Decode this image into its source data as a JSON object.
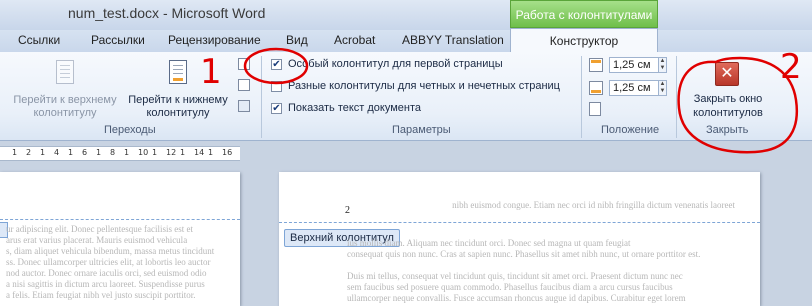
{
  "window": {
    "title": "num_test.docx  -  Microsoft Word"
  },
  "context_tab_header": "Работа с колонтитулами",
  "tabs": [
    {
      "label": "Ссылки"
    },
    {
      "label": "Рассылки"
    },
    {
      "label": "Рецензирование"
    },
    {
      "label": "Вид"
    },
    {
      "label": "Acrobat"
    },
    {
      "label": "ABBYY Translation"
    },
    {
      "label": "Конструктор",
      "active": true
    }
  ],
  "ribbon": {
    "transitions": {
      "group_label": "Переходы",
      "go_to_header": {
        "line1": "Перейти к верхнему",
        "line2": "колонтитулу",
        "enabled": false
      },
      "go_to_footer": {
        "line1": "Перейти к нижнему",
        "line2": "колонтитулу",
        "enabled": true
      }
    },
    "parameters": {
      "group_label": "Параметры",
      "options": [
        {
          "label": "Особый колонтитул для первой страницы",
          "checked": true
        },
        {
          "label": "Разные колонтитулы для четных и нечетных страниц",
          "checked": false
        },
        {
          "label": "Показать текст документа",
          "checked": true
        }
      ]
    },
    "position": {
      "group_label": "Положение",
      "header_distance": "1,25 см",
      "footer_distance": "1,25 см"
    },
    "close": {
      "group_label": "Закрыть",
      "button_line1": "Закрыть окно",
      "button_line2": "колонтитулов"
    }
  },
  "ruler": {
    "ticks": [
      "1",
      "2",
      "1",
      "4",
      "1",
      "6",
      "1",
      "8",
      "1",
      "10",
      "1",
      "12",
      "1",
      "14",
      "1",
      "16"
    ]
  },
  "document": {
    "header_tag": "Верхний колонтитул",
    "page_number": "2",
    "left_page_lines": [
      "ur adipiscing elit. Donec pellentesque facilisis est et",
      "arus erat varius placerat. Mauris euismod vehicula",
      "s, diam aliquet vehicula bibendum, massa metus tincidunt",
      "ss. Donec ullamcorper ultricies elit, at lobortis leo auctor",
      "nod auctor. Donec ornare iaculis orci, sed euismod odio",
      "a nisi sagittis in dictum arcu laoreet. Suspendisse purus",
      "a felis. Etiam feugiat nibh vel justo suscipit porttitor."
    ],
    "right_page_top_line": "nibh euismod congue. Etiam nec orci id nibh fringilla dictum venenatis laoreet",
    "right_page_lines": [
      "ius mollis diam. Aliquam nec tincidunt orci. Donec sed magna ut quam feugiat",
      "consequat quis non nunc. Cras at sapien nunc. Phasellus sit amet nibh nunc, ut ornare porttitor est.",
      "",
      "Duis mi tellus, consequat vel tincidunt quis, tincidunt sit amet orci. Praesent dictum nunc nec",
      "sem faucibus sed posuere quam commodo. Phasellus faucibus diam a arcu cursus faucibus",
      "ullamcorper neque convallis. Fusce accumsan rhoncus augue id dapibus. Curabitur eget lorem"
    ]
  },
  "annotations": {
    "marker_1": "1",
    "marker_2": "2",
    "color": "#e00000"
  }
}
